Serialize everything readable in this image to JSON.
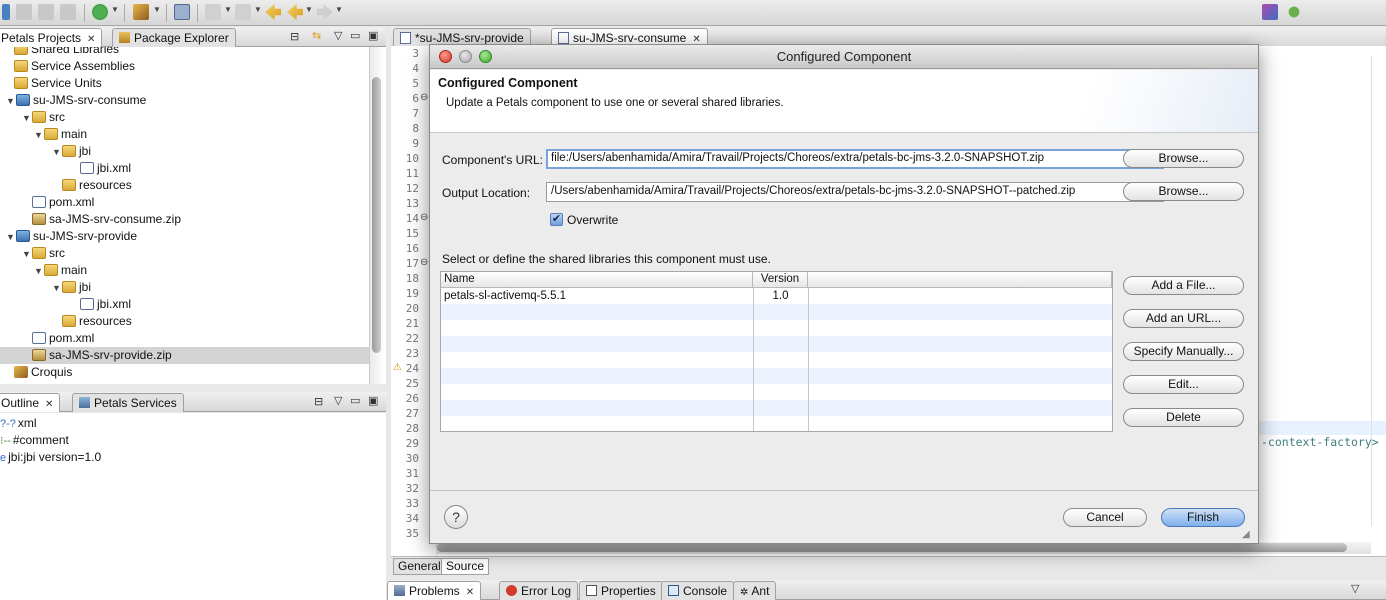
{
  "left_panel": {
    "tabs": [
      {
        "label": "Petals Projects",
        "active": true
      },
      {
        "label": "Package Explorer",
        "active": false
      }
    ],
    "tree": [
      {
        "label": "Shared Libraries",
        "depth": 0,
        "icon": "folder",
        "twisty": ""
      },
      {
        "label": "Service Assemblies",
        "depth": 0,
        "icon": "folder",
        "twisty": ""
      },
      {
        "label": "Service Units",
        "depth": 0,
        "icon": "folder",
        "twisty": ""
      },
      {
        "label": "su-JMS-srv-consume",
        "depth": 1,
        "icon": "proj",
        "twisty": "▼"
      },
      {
        "label": "src",
        "depth": 2,
        "icon": "folder",
        "twisty": "▼"
      },
      {
        "label": "main",
        "depth": 3,
        "icon": "folder",
        "twisty": "▼"
      },
      {
        "label": "jbi",
        "depth": 4,
        "icon": "folder",
        "twisty": "▼"
      },
      {
        "label": "jbi.xml",
        "depth": 5,
        "icon": "xml",
        "twisty": ""
      },
      {
        "label": "resources",
        "depth": 4,
        "icon": "folder",
        "twisty": ""
      },
      {
        "label": "pom.xml",
        "depth": 2,
        "icon": "xml",
        "twisty": ""
      },
      {
        "label": "sa-JMS-srv-consume.zip",
        "depth": 2,
        "icon": "zip",
        "twisty": ""
      },
      {
        "label": "su-JMS-srv-provide",
        "depth": 1,
        "icon": "proj",
        "twisty": "▼"
      },
      {
        "label": "src",
        "depth": 2,
        "icon": "folder",
        "twisty": "▼"
      },
      {
        "label": "main",
        "depth": 3,
        "icon": "folder",
        "twisty": "▼"
      },
      {
        "label": "jbi",
        "depth": 4,
        "icon": "folder",
        "twisty": "▼"
      },
      {
        "label": "jbi.xml",
        "depth": 5,
        "icon": "xml",
        "twisty": ""
      },
      {
        "label": "resources",
        "depth": 4,
        "icon": "folder",
        "twisty": ""
      },
      {
        "label": "pom.xml",
        "depth": 2,
        "icon": "xml",
        "twisty": ""
      },
      {
        "label": "sa-JMS-srv-provide.zip",
        "depth": 2,
        "icon": "zip",
        "twisty": "",
        "selected": true
      },
      {
        "label": "Croquis",
        "depth": 0,
        "icon": "pencil",
        "twisty": ""
      }
    ]
  },
  "outline_panel": {
    "tabs": [
      {
        "label": "Outline",
        "active": true
      },
      {
        "label": "Petals Services",
        "active": false
      }
    ],
    "items": [
      {
        "label": "xml",
        "prefix": "?-?"
      },
      {
        "label": "#comment",
        "prefix": "⁝--"
      },
      {
        "label": "jbi:jbi version=1.0",
        "prefix": "e"
      }
    ]
  },
  "editor": {
    "tabs": [
      {
        "label": "*su-JMS-srv-provide",
        "active": false
      },
      {
        "label": "su-JMS-srv-consume",
        "active": true
      }
    ],
    "line_numbers": [
      "3",
      "4",
      "5",
      "6",
      "7",
      "8",
      "9",
      "10",
      "11",
      "12",
      "13",
      "14",
      "15",
      "16",
      "17",
      "18",
      "19",
      "20",
      "21",
      "22",
      "23",
      "24",
      "25",
      "26",
      "27",
      "28",
      "29",
      "30",
      "31",
      "32",
      "33",
      "34",
      "35"
    ],
    "visible_code_fragment": "-context-factory>",
    "bottom_tabs": [
      {
        "label": "General",
        "active": false
      },
      {
        "label": "Source",
        "active": true
      }
    ]
  },
  "bottom_panel": {
    "tabs": [
      "Problems",
      "Error Log",
      "Properties",
      "Console",
      "Ant"
    ]
  },
  "dialog": {
    "window_title": "Configured Component",
    "header_title": "Configured Component",
    "header_description": "Update a Petals component to use one or several shared libraries.",
    "component_url_label": "Component's URL:",
    "component_url_value": "file:/Users/abenhamida/Amira/Travail/Projects/Choreos/extra/petals-bc-jms-3.2.0-SNAPSHOT.zip",
    "output_location_label": "Output Location:",
    "output_location_value": "/Users/abenhamida/Amira/Travail/Projects/Choreos/extra/petals-bc-jms-3.2.0-SNAPSHOT--patched.zip",
    "browse_label": "Browse...",
    "overwrite_label": "Overwrite",
    "overwrite_checked": true,
    "libraries_instruction": "Select or define the shared libraries this component must use.",
    "table_columns": [
      "Name",
      "Version"
    ],
    "table_rows": [
      {
        "name": "petals-sl-activemq-5.5.1",
        "version": "1.0"
      }
    ],
    "side_buttons": [
      "Add a File...",
      "Add an URL...",
      "Specify Manually...",
      "Edit...",
      "Delete"
    ],
    "help_label": "?",
    "cancel_label": "Cancel",
    "finish_label": "Finish"
  }
}
